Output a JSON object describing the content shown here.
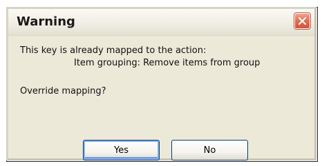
{
  "dialog": {
    "title": "Warning",
    "message_line1": "This key is already mapped to the action:",
    "message_line2": "Item grouping: Remove items from group",
    "question": "Override mapping?",
    "close_icon": "close-x-icon"
  },
  "buttons": {
    "yes_label": "Yes",
    "no_label": "No"
  },
  "colors": {
    "dialog_background": "#ece9d8",
    "close_button": "#e27256",
    "button_border": "#003c74",
    "focus_ring": "#8cb0ea"
  }
}
